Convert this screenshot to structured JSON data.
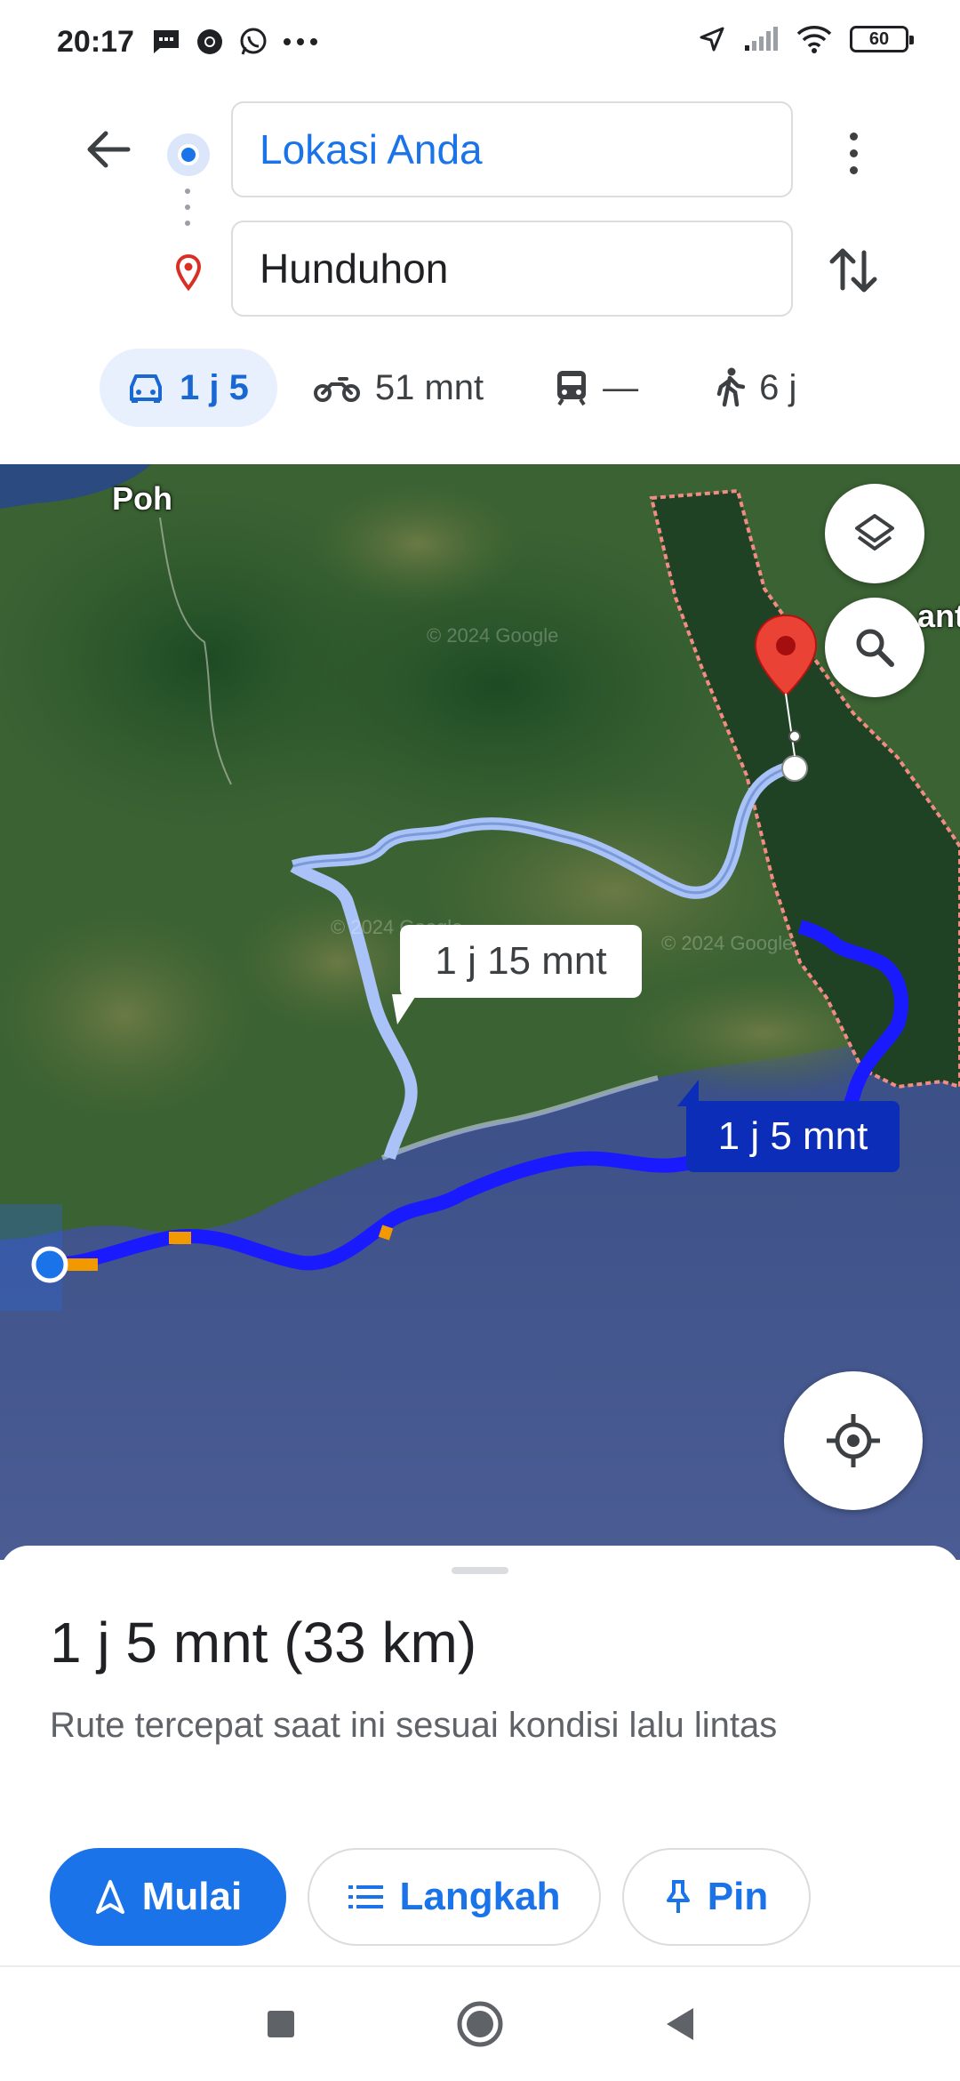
{
  "status_bar": {
    "time": "20:17",
    "battery": "60"
  },
  "directions": {
    "origin": "Lokasi Anda",
    "destination": "Hunduhon",
    "modes": [
      {
        "name": "car",
        "label": "1 j 5",
        "selected": true
      },
      {
        "name": "motorcycle",
        "label": "51 mnt"
      },
      {
        "name": "transit",
        "label": "—"
      },
      {
        "name": "walk",
        "label": "6 j"
      }
    ]
  },
  "map": {
    "labels": [
      "Poh",
      "ant"
    ],
    "watermark": "© 2024 Google",
    "alt_route_time": "1 j 15 mnt",
    "main_route_time": "1 j 5 mnt",
    "colors": {
      "main_route": "#1a1aff",
      "alt_route": "#a9c2f7",
      "traffic": "#f29900",
      "destination_pin": "#ea4335"
    }
  },
  "sheet": {
    "duration": "1 j 5 mnt",
    "distance": "(33 km)",
    "description": "Rute tercepat saat ini sesuai kondisi lalu lintas",
    "start_label": "Mulai",
    "steps_label": "Langkah",
    "pin_label": "Pin"
  },
  "accent": "#1a73e8"
}
